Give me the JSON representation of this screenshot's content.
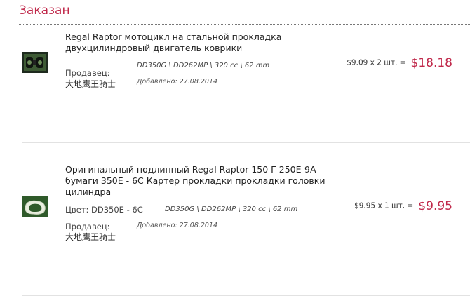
{
  "section": {
    "title": "Заказан"
  },
  "items": [
    {
      "title_lines": [
        "Regal Raptor мотоцикл на стальной прокладка",
        "двухцилиндровый двигатель коврики"
      ],
      "spec": "DD350G \\ DD262MP \\ 320 cc \\ 62 mm",
      "color_label": "",
      "seller_label": "Продавец:",
      "seller_name": "大地鹰王骑士",
      "added": "Добавлено: 27.08.2014",
      "unit_price": "$9.09 x 2 шт. =",
      "total": "$18.18",
      "thumb_icon": "gasket-kit-thumbnail"
    },
    {
      "title_lines": [
        "Оригинальный подлинный Regal Raptor 150 Г 250E-9A",
        "бумаги 350E - 6C Картер прокладки прокладки головки",
        "цилиндра"
      ],
      "spec": "DD350G \\ DD262MP \\ 320 cc \\ 62 mm",
      "color_label": "Цвет: DD350E - 6C",
      "seller_label": "Продавец:",
      "seller_name": "大地鹰王骑士",
      "added": "Добавлено: 27.08.2014",
      "unit_price": "$9.95 x 1 шт. =",
      "total": "$9.95",
      "thumb_icon": "crankcase-gasket-thumbnail"
    }
  ],
  "colors": {
    "accent": "#c0284a"
  }
}
